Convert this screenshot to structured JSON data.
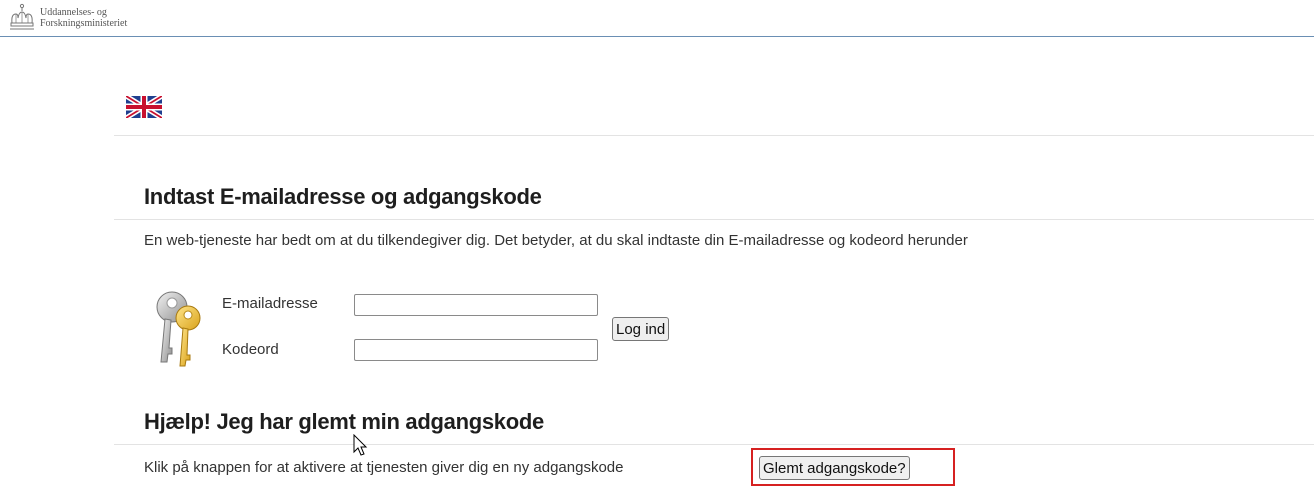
{
  "header": {
    "ministry_line1": "Uddannelses- og",
    "ministry_line2": "Forskningsministeriet",
    "logo_icon": "crown-icon"
  },
  "language": {
    "icon": "uk-flag-icon"
  },
  "login": {
    "title": "Indtast E-mailadresse og adgangskode",
    "intro": "En web-tjeneste har bedt om at du tilkendegiver dig. Det betyder, at du skal indtaste din E-mailadresse og kodeord herunder",
    "email_label": "E-mailadresse",
    "email_value": "",
    "password_label": "Kodeord",
    "password_value": "",
    "login_button": "Log ind",
    "keys_icon": "keys-icon"
  },
  "help": {
    "title": "Hjælp! Jeg har glemt min adgangskode",
    "text": "Klik på knappen for at aktivere at tjenesten giver dig en ny adgangskode",
    "forgot_button": "Glemt adgangskode?"
  },
  "colors": {
    "header_rule": "#6a8fb4",
    "highlight": "#d62121",
    "text": "#333333"
  }
}
